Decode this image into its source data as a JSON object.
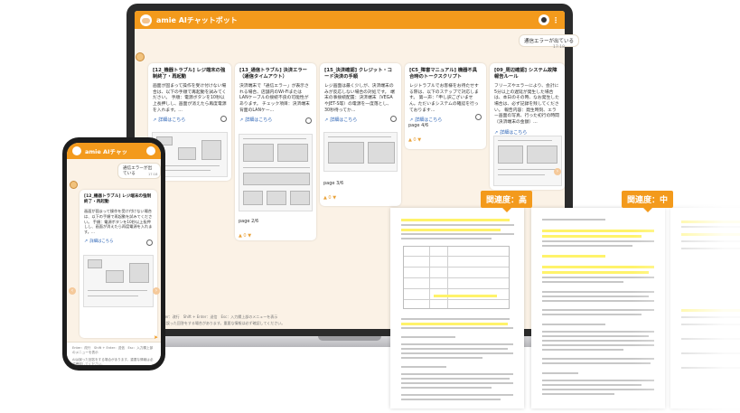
{
  "app": {
    "title": "amie AIチャットボット",
    "phone_title": "amie AIチャッ"
  },
  "chat": {
    "user_message": "通信エラーが出ている",
    "time": "17:18",
    "input_hint": "Enter：改行　Shift + Enter：送信　Esc：入力欄上部のメニューを表示",
    "disclaimer": "AIは誤った回答をする場合があります。重要な情報は必ず確認してください。"
  },
  "cards": [
    {
      "title": "[12_機器トラブル] レジ端末の強制終了・再起動",
      "body": "画面が固まって操作を受け付けない場合は、以下の手順で再起動を試みてください。  手順：電源ボタンを10秒以上長押しし、画面が消えたら再度電源を入れます。...",
      "link": "詳細はこちら",
      "page": ""
    },
    {
      "title": "[13_通信トラブル] 決済エラー（通信タイムアウト）",
      "body": "決済端末で「通信エラー」が表示される場合、店舗内のWi-Fiまたは LANケーブルの接続不良の可能性があります。  チェック項目：決済端末背面のLANケー...",
      "link": "詳細はこちら",
      "page": "page 2/6"
    },
    {
      "title": "[15_決済確認] クレジット・コード決済の手順",
      "body": "レジ画面は最く少しが、決済端末のみが反応しない場合の対処です。  端末の事接続配置：決済端末（VEGA やJET-S等）の電源を一度落とし、30秒待ってか...",
      "link": "詳細はこちら",
      "page": "page 3/6"
    },
    {
      "title": "[C5_障害マニュアル] 機器不具合時のトークスクリプト",
      "body": "レジトラブルでお客様をお待たせする際は、以下のステップで対応します。  第一声：「申し訳ございません。ただいまシステムの確認を行っております...",
      "link": "詳細はこちら",
      "page": "page 4/6"
    },
    {
      "title": "[09_周辺確認] システム故障報告ルール",
      "body": "フリーズやエラーにより、会計に5分以上の遅延が発生した場合は、本日のその時、なお発生した場合は、必ず記録を残してください。  報告内容：発生時刻、エラー画面の写真、行った初行の時間（決済端末の金額）...",
      "link": "詳細はこちら",
      "page": ""
    }
  ],
  "relevance": {
    "high": "関連度：高",
    "mid": "関連度：中"
  }
}
